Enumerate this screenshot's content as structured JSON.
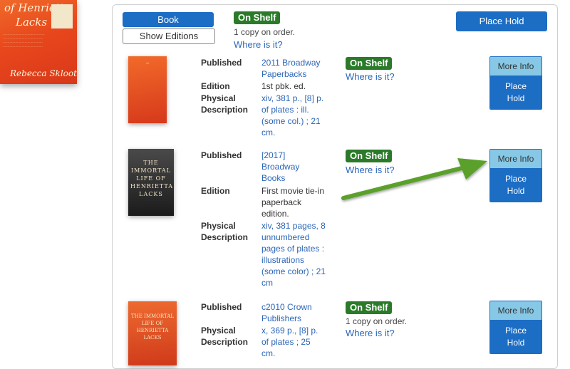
{
  "main_cover": {
    "title_fragment": "of Henrietta",
    "title_fragment2": "Lacks",
    "author": "Rebecca Skloot"
  },
  "top": {
    "book_label": "Book",
    "show_editions_label": "Show Editions",
    "status": "On Shelf",
    "copies_note": "1 copy on order.",
    "where_label": "Where is it?",
    "place_hold_label": "Place Hold"
  },
  "labels": {
    "published": "Published",
    "edition": "Edition",
    "physical": "Physical Description"
  },
  "editions": [
    {
      "published": "2011 Broadway Paperbacks",
      "edition": "1st pbk. ed.",
      "physical": "xiv, 381 p., [8] p. of plates : ill. (some col.) ; 21 cm.",
      "status": "On Shelf",
      "copies_note": "",
      "where_label": "Where is it?",
      "more_info_label": "More Info",
      "place_hold_label": "Place Hold"
    },
    {
      "published": "[2017] Broadway Books",
      "edition": "First movie tie-in paperback edition.",
      "physical": "xiv, 381 pages, 8 unnumbered pages of plates : illustrations (some color) ; 21 cm",
      "status": "On Shelf",
      "copies_note": "",
      "where_label": "Where is it?",
      "more_info_label": "More Info",
      "place_hold_label": "Place Hold",
      "cover_text": "THE IMMORTAL LIFE OF HENRIETTA LACKS"
    },
    {
      "published": "c2010 Crown Publishers",
      "edition": "",
      "physical": "x, 369 p., [8] p. of plates ; 25 cm.",
      "status": "On Shelf",
      "copies_note": "1 copy on order.",
      "where_label": "Where is it?",
      "more_info_label": "More Info",
      "place_hold_label": "Place Hold",
      "cover_text": "THE IMMORTAL LIFE OF HENRIETTA LACKS"
    }
  ],
  "annotation": {
    "arrow_color": "#5aa02c"
  },
  "colors": {
    "primary": "#1c6dc4",
    "status_green": "#2a7a2a",
    "link": "#2b66b8",
    "more_info_bg": "#86c8e6"
  }
}
